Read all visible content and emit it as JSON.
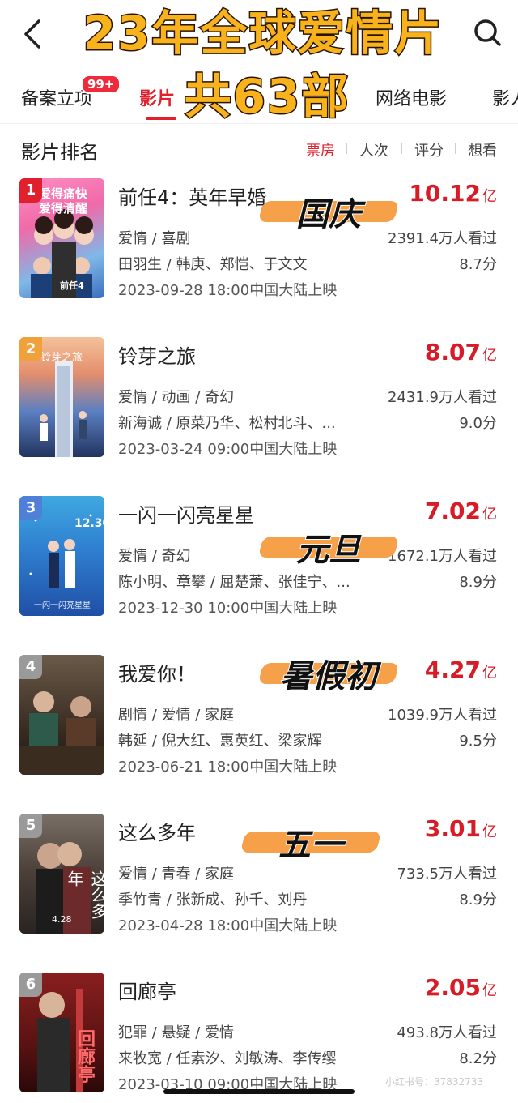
{
  "header": {
    "back_icon": "chevron-left-icon",
    "search_icon": "search-icon"
  },
  "overlay": {
    "title_line1": "23年全球爱情片",
    "title_line2": "共63部"
  },
  "tabs": {
    "items": [
      {
        "label": "备案立项",
        "badge": "99+"
      },
      {
        "label": "影片"
      },
      {
        "label": "网络电影"
      },
      {
        "label": "影人"
      }
    ],
    "active_index": 1
  },
  "ranking": {
    "title": "影片排名",
    "sort_options": [
      "票房",
      "人次",
      "评分",
      "想看"
    ],
    "active_sort": 0
  },
  "movies": [
    {
      "rank": "1",
      "title": "前任4：英年早婚",
      "box_value": "10.12",
      "box_unit": "亿",
      "genres": "爱情 / 喜剧",
      "views": "2391.4万人看过",
      "cast": "田羽生 / 韩庚、郑恺、于文文",
      "score": "8.7分",
      "release": "2023-09-28 18:00中国大陆上映",
      "badge_color": "#e0202c",
      "sticker": "国庆",
      "poster_text": "爱得痛快\n爱得清醒",
      "poster_caption": "前任4"
    },
    {
      "rank": "2",
      "title": "铃芽之旅",
      "box_value": "8.07",
      "box_unit": "亿",
      "genres": "爱情 / 动画 / 奇幻",
      "views": "2431.9万人看过",
      "cast": "新海诚 / 原菜乃华、松村北斗、...",
      "score": "9.0分",
      "release": "2023-03-24 09:00中国大陆上映",
      "badge_color": "#f0a13c",
      "sticker": "",
      "poster_text": "铃芽之旅",
      "poster_caption": ""
    },
    {
      "rank": "3",
      "title": "一闪一闪亮星星",
      "box_value": "7.02",
      "box_unit": "亿",
      "genres": "爱情 / 奇幻",
      "views": "1672.1万人看过",
      "cast": "陈小明、章攀 / 屈楚萧、张佳宁、...",
      "score": "8.9分",
      "release": "2023-12-30 10:00中国大陆上映",
      "badge_color": "#4f7fd6",
      "sticker": "元旦",
      "poster_text": "12.30",
      "poster_caption": "一闪一闪亮星星"
    },
    {
      "rank": "4",
      "title": "我爱你！",
      "box_value": "4.27",
      "box_unit": "亿",
      "genres": "剧情 / 爱情 / 家庭",
      "views": "1039.9万人看过",
      "cast": "韩延 / 倪大红、惠英红、梁家辉",
      "score": "9.5分",
      "release": "2023-06-21 18:00中国大陆上映",
      "badge_color": "#9a9a9a",
      "sticker": "暑假初",
      "poster_text": "",
      "poster_caption": ""
    },
    {
      "rank": "5",
      "title": "这么多年",
      "box_value": "3.01",
      "box_unit": "亿",
      "genres": "爱情 / 青春 / 家庭",
      "views": "733.5万人看过",
      "cast": "季竹青 / 张新成、孙千、刘丹",
      "score": "8.9分",
      "release": "2023-04-28 18:00中国大陆上映",
      "badge_color": "#9a9a9a",
      "sticker": "五一",
      "poster_text": "这么多年",
      "poster_caption": "4.28"
    },
    {
      "rank": "6",
      "title": "回廊亭",
      "box_value": "2.05",
      "box_unit": "亿",
      "genres": "犯罪 / 悬疑 / 爱情",
      "views": "493.8万人看过",
      "cast": "来牧宽 / 任素汐、刘敏涛、李传缨",
      "score": "8.2分",
      "release": "2023-03-10 09:00中国大陆上映",
      "badge_color": "#9a9a9a",
      "sticker": "",
      "poster_text": "回廊亭",
      "poster_caption": ""
    }
  ],
  "watermark": "小红书号：37832733"
}
